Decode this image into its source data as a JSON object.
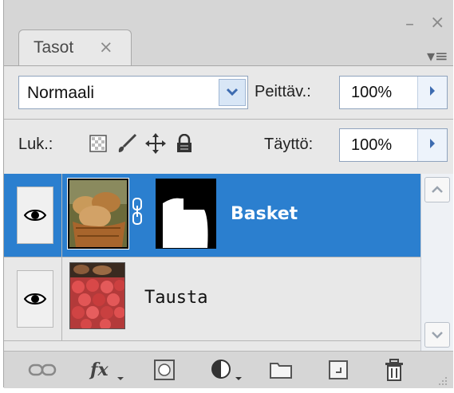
{
  "panel": {
    "window_controls": {
      "minimize": "–",
      "close": "×",
      "menu": "▾≡"
    },
    "tab": {
      "label": "Tasot",
      "close": "×"
    }
  },
  "toolbar": {
    "blend_mode": "Normaali",
    "opacity_label": "Peittäv.:",
    "opacity_value": "100%",
    "lock_label": "Luk.:",
    "fill_label": "Täyttö:",
    "fill_value": "100%"
  },
  "layers": [
    {
      "name": "Basket",
      "selected": true,
      "visible": true,
      "has_mask": true
    },
    {
      "name": "Tausta",
      "selected": false,
      "visible": true,
      "has_mask": false
    }
  ],
  "icons": {
    "lock_transparent": "lock-transparency-icon",
    "lock_image": "brush-icon",
    "lock_position": "move-icon",
    "lock_all": "lock-icon",
    "bottom": [
      "link-icon",
      "fx-icon",
      "mask-icon",
      "adjustment-icon",
      "folder-icon",
      "new-layer-icon",
      "trash-icon"
    ]
  },
  "colors": {
    "selection": "#2b7fcf",
    "accent": "#3d6bb0"
  }
}
